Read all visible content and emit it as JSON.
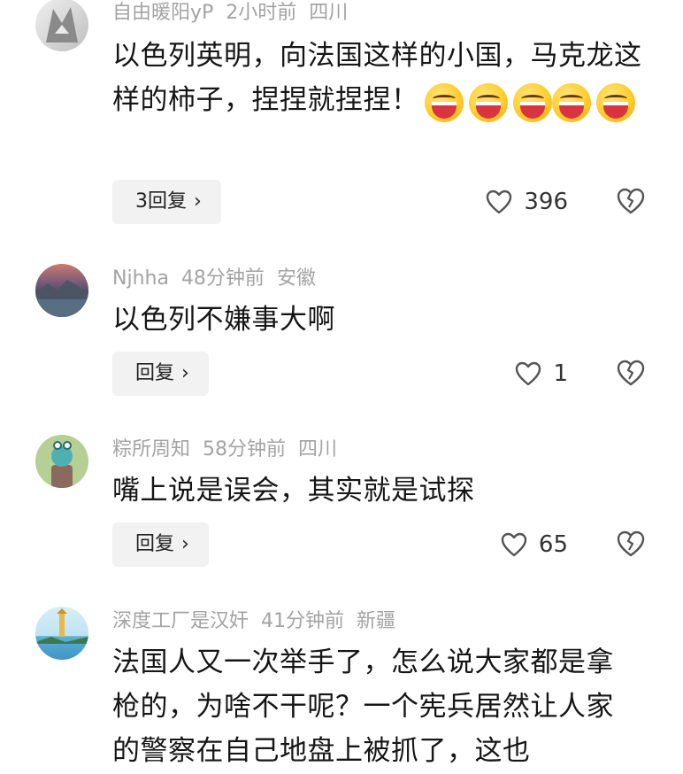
{
  "comments": [
    {
      "username": "自由暖阳yP",
      "time": "2小时前",
      "location": "四川",
      "text": "以色列英明，向法国这样的小国，马克龙这样的柿子，捏捏就捏捏！",
      "emoji_count": 5,
      "reply_label": "3回复",
      "likes": "396"
    },
    {
      "username": "Njhha",
      "time": "48分钟前",
      "location": "安徽",
      "text": "以色列不嫌事大啊",
      "reply_label": "回复",
      "likes": "1"
    },
    {
      "username": "粽所周知",
      "time": "58分钟前",
      "location": "四川",
      "text": "嘴上说是误会，其实就是试探",
      "reply_label": "回复",
      "likes": "65"
    },
    {
      "username": "深度工厂是汉奸",
      "time": "41分钟前",
      "location": "新疆",
      "text": "法国人又一次举手了，怎么说大家都是拿枪的，为啥不干呢？一个宪兵居然让人家的警察在自己地盘上被抓了，这也"
    }
  ],
  "icons": {
    "like": "heart-outline-icon",
    "dislike": "broken-heart-icon",
    "reply_chevron": "chevron-right-icon",
    "emoji": "laughing-emoji-icon"
  },
  "colors": {
    "meta_text": "#a3a3a3",
    "reply_bg": "#f2f2f2",
    "body_text": "#161616"
  }
}
